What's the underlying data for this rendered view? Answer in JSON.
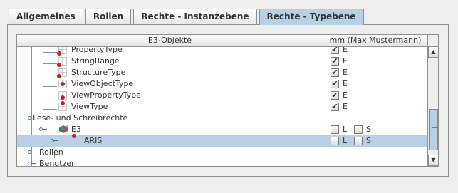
{
  "tabs": [
    {
      "label": "Allgemeines",
      "active": false
    },
    {
      "label": "Rollen",
      "active": false
    },
    {
      "label": "Rechte - Instanzebene",
      "active": false
    },
    {
      "label": "Rechte - Typebene",
      "active": true
    }
  ],
  "table": {
    "columns": [
      "E3-Objekte",
      "mm (Max Mustermann)"
    ],
    "rows": [
      {
        "label": "PropertyType",
        "perm": "E",
        "checked": true
      },
      {
        "label": "StringRange",
        "perm": "E",
        "checked": true
      },
      {
        "label": "StructureType",
        "perm": "E",
        "checked": true
      },
      {
        "label": "ViewObjectType",
        "perm": "E",
        "checked": true
      },
      {
        "label": "ViewPropertyType",
        "perm": "E",
        "checked": true
      },
      {
        "label": "ViewType",
        "perm": "E",
        "checked": true
      },
      {
        "label": "Lese- und Schreibrechte"
      },
      {
        "label": "E3",
        "perm_l": "L",
        "perm_s": "S"
      },
      {
        "label": "ARIS",
        "perm_l": "L",
        "perm_s": "S",
        "selected": true
      },
      {
        "label": "Rollen"
      },
      {
        "label": "Benutzer"
      }
    ]
  },
  "icons": {
    "expand": "key-handle-icon",
    "type": "type-node-icon",
    "marker": "red-dot-icon",
    "e3": "e3-cube-icon"
  },
  "colors": {
    "selection": "#b8cfe5",
    "accent_red": "#cc2020"
  }
}
